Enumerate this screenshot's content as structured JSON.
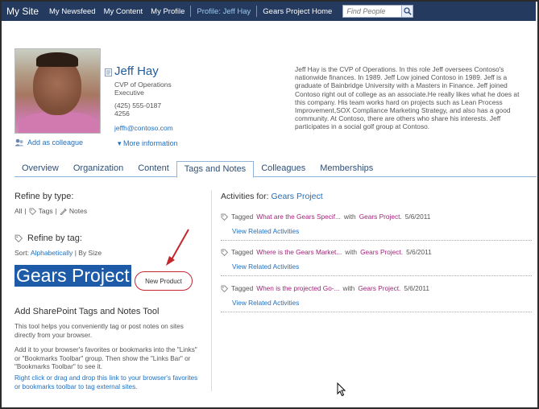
{
  "topnav": {
    "site": "My Site",
    "links": [
      "My Newsfeed",
      "My Content",
      "My Profile",
      "Profile: Jeff Hay",
      "Gears Project Home"
    ],
    "search_placeholder": "Find People"
  },
  "profile": {
    "name": "Jeff Hay",
    "title_line1": "CVP of Operations",
    "title_line2": "Executive",
    "phone_line1": "(425) 555-0187",
    "phone_line2": "4256",
    "email": "jeffh@contoso.com",
    "add_colleague": "Add as colleague",
    "more_info": "More information",
    "bio": "Jeff Hay is the CVP of Operations. In this role Jeff oversees Contoso's nationwide finances. In 1989. Jeff Low joined Contoso in 1989. Jeff is a graduate of Bainbridge University with a Masters in Finance. Jeff joined Contoso right out of college as an associate.He really likes what he does at this company. His team works hard on projects such as Lean Process Improvement,SOX Compliance Marketing Strategy, and also has a good community. At Contoso, there are others who share his interests. Jeff participates in a social golf group at Contoso."
  },
  "tabs": [
    "Overview",
    "Organization",
    "Content",
    "Tags and Notes",
    "Colleagues",
    "Memberships"
  ],
  "left": {
    "refine_type": "Refine by type:",
    "filter_all": "All",
    "filter_tags": "Tags",
    "filter_notes": "Notes",
    "refine_tag": "Refine by tag:",
    "sort_label": "Sort:",
    "sort_alpha": "Alphabetically",
    "sort_size": "By Size",
    "big_tag": "Gears Project",
    "small_tag": "New Product",
    "addsp_title": "Add SharePoint Tags and Notes Tool",
    "p1": "This tool helps you conveniently tag or post notes on sites directly from your browser.",
    "p2": "Add it to your browser's favorites or bookmarks into the \"Links\" or \"Bookmarks Toolbar\" group. Then show the \"Links Bar\" or \"Bookmarks Toolbar\" to see it.",
    "p3": "Right click or drag and drop this link to your browser's favorites or bookmarks toolbar to tag external sites."
  },
  "right": {
    "activities_label": "Activities for:",
    "activities_target": "Gears Project",
    "items": [
      {
        "tagged": "Tagged",
        "title": "What are the Gears Specif...",
        "with": "with",
        "tag": "Gears Project.",
        "date": "5/6/2011",
        "view": "View Related Activities"
      },
      {
        "tagged": "Tagged",
        "title": "Where is the Gears Market...",
        "with": "with",
        "tag": "Gears Project.",
        "date": "5/6/2011",
        "view": "View Related Activities"
      },
      {
        "tagged": "Tagged",
        "title": "When is the projected Go-...",
        "with": "with",
        "tag": "Gears Project.",
        "date": "5/6/2011",
        "view": "View Related Activities"
      }
    ]
  }
}
